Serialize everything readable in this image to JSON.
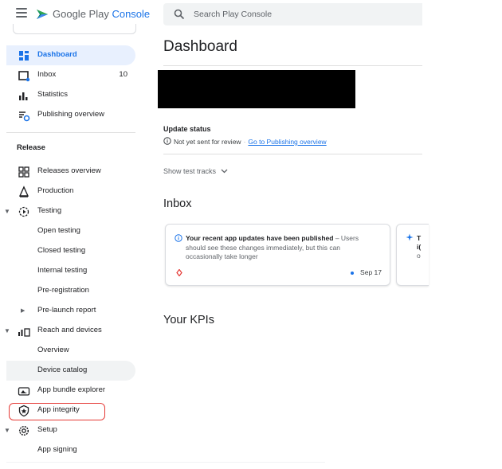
{
  "brand": {
    "google": "Google Play",
    "console": "Console"
  },
  "search": {
    "placeholder": "Search Play Console"
  },
  "sidebar": {
    "main": [
      {
        "label": "Dashboard"
      },
      {
        "label": "Inbox",
        "count": "10"
      },
      {
        "label": "Statistics"
      },
      {
        "label": "Publishing overview"
      }
    ],
    "release_title": "Release",
    "release": [
      {
        "label": "Releases overview"
      },
      {
        "label": "Production"
      },
      {
        "label": "Testing"
      },
      {
        "label": "Open testing"
      },
      {
        "label": "Closed testing"
      },
      {
        "label": "Internal testing"
      },
      {
        "label": "Pre-registration"
      },
      {
        "label": "Pre-launch report"
      },
      {
        "label": "Reach and devices"
      },
      {
        "label": "Overview"
      },
      {
        "label": "Device catalog"
      },
      {
        "label": "App bundle explorer"
      },
      {
        "label": "App integrity"
      },
      {
        "label": "Setup"
      },
      {
        "label": "App signing"
      }
    ]
  },
  "main": {
    "title": "Dashboard",
    "update_status": {
      "title": "Update status",
      "text": "Not yet sent for review",
      "link": "Go to Publishing overview"
    },
    "show_test_tracks": "Show test tracks",
    "inbox_title": "Inbox",
    "inbox_card": {
      "title": "Your recent app updates have been published",
      "body": " – Users should see these changes immediately, but this can occasionally take longer",
      "date": "Sep 17"
    },
    "card2_partial": {
      "line1": "T",
      "line2": "i(",
      "line3": "o"
    },
    "kpis_title": "Your KPIs"
  },
  "colors": {
    "accent": "#1a73e8",
    "active_bg": "#e8f0fe",
    "highlight": "#e53935"
  }
}
